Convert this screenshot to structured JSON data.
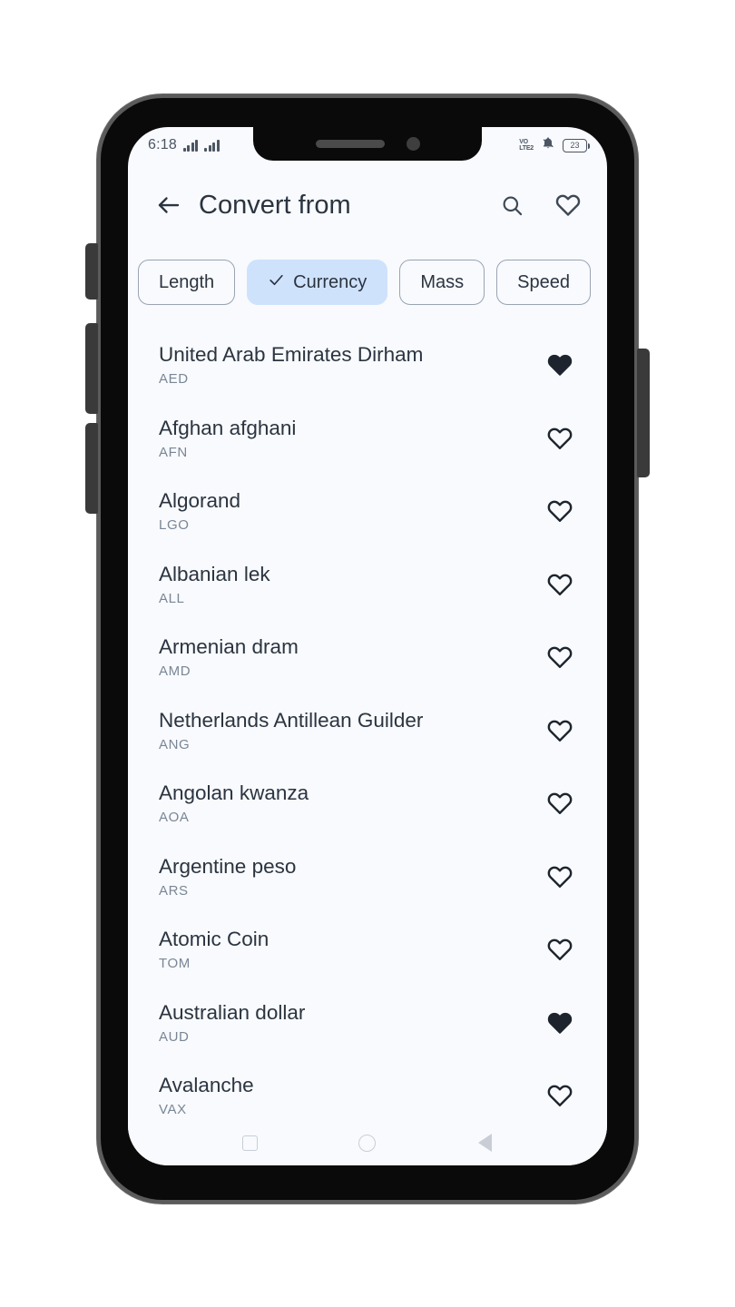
{
  "statusbar": {
    "time": "6:18",
    "network_label": "VO\nLTE2",
    "volte_line1": "VO",
    "volte_line2": "LTE2",
    "signal_icon": "signal-bars-icon",
    "signal_icon_2": "signal-bars-icon-sim2",
    "mute_icon": "bell-muted-icon",
    "battery_percent": "23"
  },
  "appbar": {
    "back_icon": "arrow-left-icon",
    "title": "Convert from",
    "search_icon": "search-icon",
    "favorites_icon": "heart-outline-icon"
  },
  "chips": [
    {
      "label": "Length",
      "selected": false
    },
    {
      "label": "Currency",
      "selected": true
    },
    {
      "label": "Mass",
      "selected": false
    },
    {
      "label": "Speed",
      "selected": false
    }
  ],
  "list": [
    {
      "name": "United Arab Emirates Dirham",
      "code": "AED",
      "favorite": true
    },
    {
      "name": "Afghan afghani",
      "code": "AFN",
      "favorite": false
    },
    {
      "name": "Algorand",
      "code": "LGO",
      "favorite": false
    },
    {
      "name": "Albanian lek",
      "code": "ALL",
      "favorite": false
    },
    {
      "name": "Armenian dram",
      "code": "AMD",
      "favorite": false
    },
    {
      "name": "Netherlands Antillean Guilder",
      "code": "ANG",
      "favorite": false
    },
    {
      "name": "Angolan kwanza",
      "code": "AOA",
      "favorite": false
    },
    {
      "name": "Argentine peso",
      "code": "ARS",
      "favorite": false
    },
    {
      "name": "Atomic Coin",
      "code": "TOM",
      "favorite": false
    },
    {
      "name": "Australian dollar",
      "code": "AUD",
      "favorite": true
    },
    {
      "name": "Avalanche",
      "code": "VAX",
      "favorite": false
    }
  ],
  "navbar": {
    "recents_icon": "square-recents-icon",
    "home_icon": "circle-home-icon",
    "back_icon": "triangle-back-icon"
  },
  "colors": {
    "screen_background": "#f8fafd",
    "chip_selected_background": "#cfe2fc",
    "primary_text": "#2b3440",
    "secondary_text": "#7a8696",
    "heart_filled": "#1d242e"
  }
}
